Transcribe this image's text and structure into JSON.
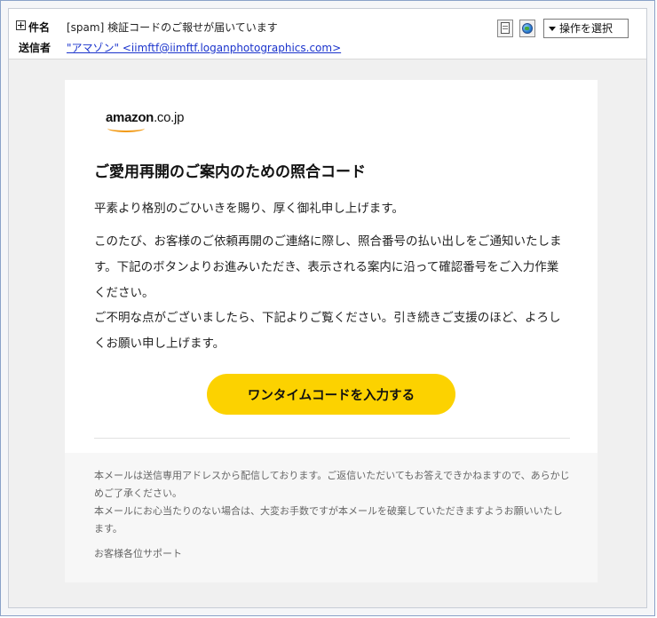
{
  "header": {
    "subject_label": "件名",
    "subject": "[spam] 検証コードのご報せが届いています",
    "sender_label": "送信者",
    "sender": "\"アマゾン\" <iimftf@iimftf.loganphotographics.com>",
    "action_select": "操作を選択"
  },
  "icons": {
    "expand": "plus-box-icon",
    "document": "document-icon",
    "globe": "globe-icon",
    "dropdown": "triangle-down-icon"
  },
  "email": {
    "logo_main": "amazon",
    "logo_tld": ".co.jp",
    "title": "ご愛用再開のご案内のための照合コード",
    "paragraphs": [
      "平素より格別のごひいきを賜り、厚く御礼申し上げます。",
      "このたび、お客様のご依頼再開のご連絡に際し、照合番号の払い出しをご通知いたします。下記のボタンよりお進みいただき、表示される案内に沿って確認番号をご入力作業ください。",
      "ご不明な点がございましたら、下記よりご覧ください。引き続きご支援のほど、よろしくお願い申し上げます。"
    ],
    "button_label": "ワンタイムコードを入力する",
    "footer_notes": [
      "本メールは送信専用アドレスから配信しております。ご返信いただいてもお答えできかねますので、あらかじめご了承ください。",
      "本メールにお心当たりのない場合は、大変お手数ですが本メールを破棄していただきますようお願いいたします。",
      "お客様各位サポート"
    ]
  },
  "colors": {
    "button": "#fcd200",
    "link": "#1a33cc",
    "logo_smile": "#f29a16",
    "body_bg": "#f0f0f0",
    "footer_bg": "#f7f7f7"
  }
}
